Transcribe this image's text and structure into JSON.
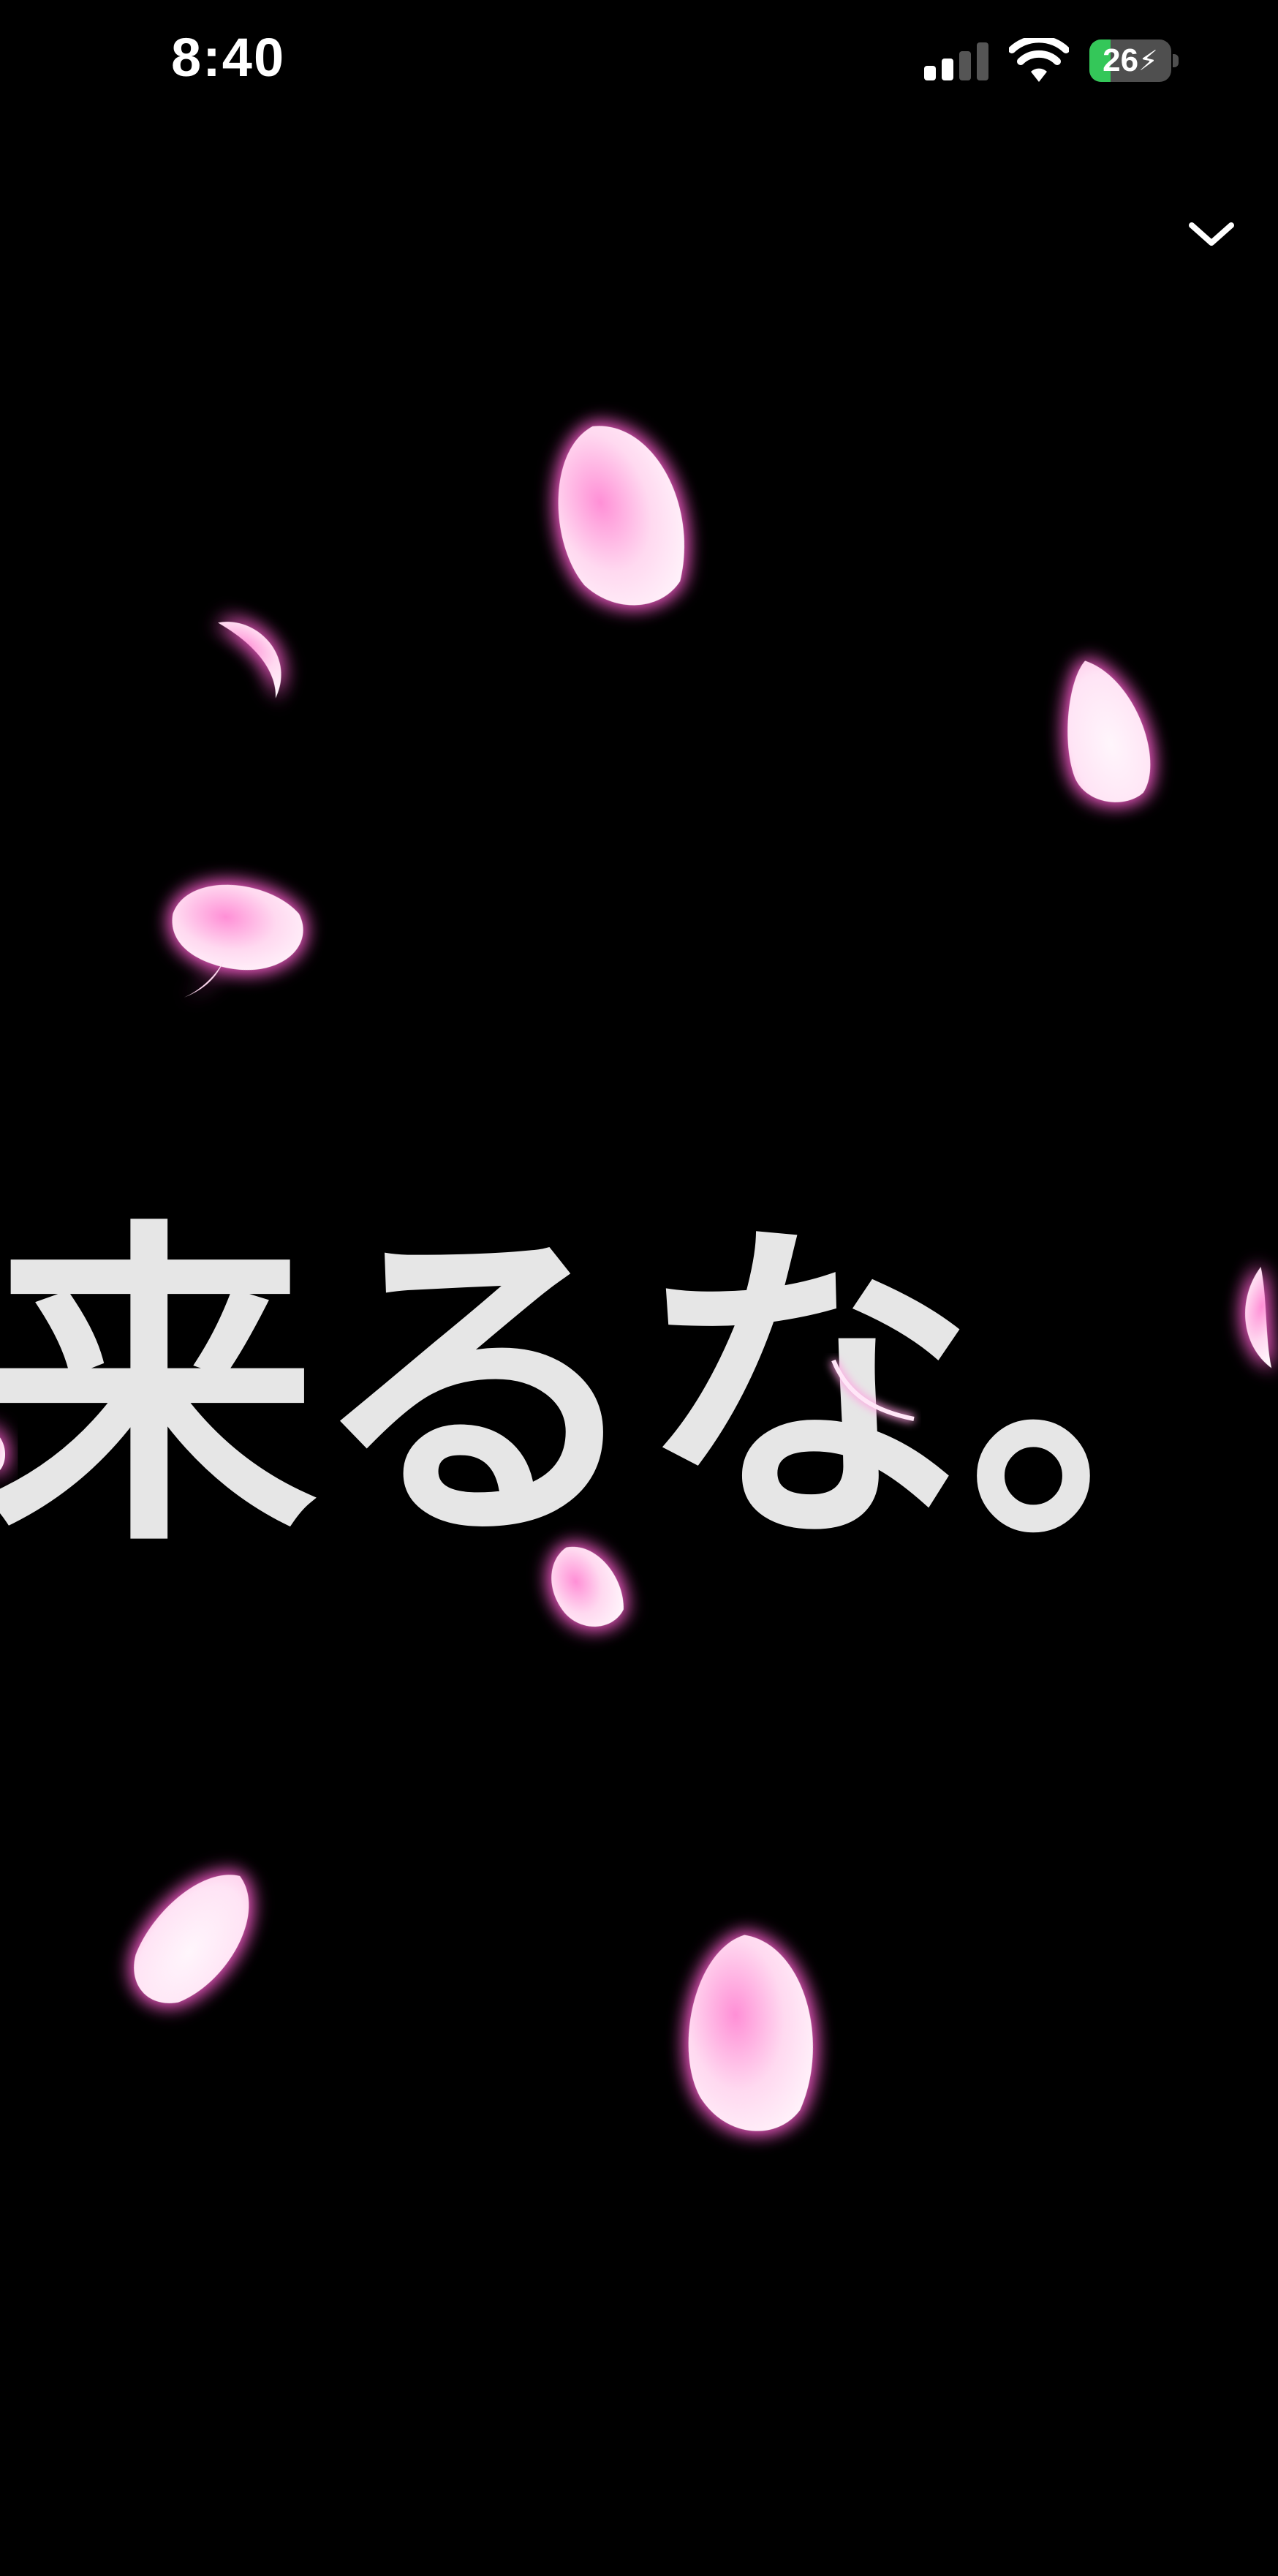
{
  "status_bar": {
    "time": "8:40",
    "signal_icon": "cellular-signal-icon",
    "signal_bars_active": 2,
    "signal_bars_total": 4,
    "wifi_icon": "wifi-icon",
    "battery_icon": "battery-charging-icon",
    "battery_level": "26",
    "battery_fraction": 0.26
  },
  "screen": {
    "message": "来るな。",
    "collapse_icon": "chevron-down-icon"
  },
  "colors": {
    "background": "#000000",
    "text": "#e6e6e6",
    "petal_glow": "#ff6ad5",
    "battery_green": "#34c759"
  }
}
